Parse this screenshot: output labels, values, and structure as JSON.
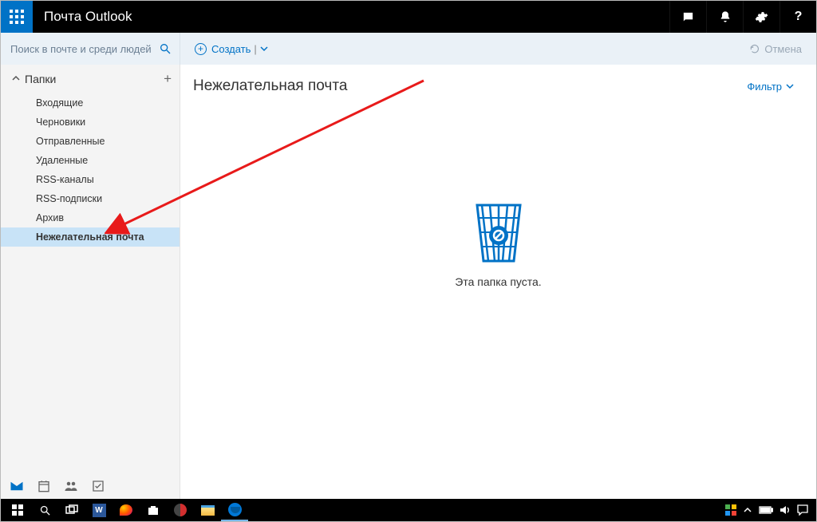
{
  "header": {
    "app_title": "Почта Outlook"
  },
  "search": {
    "placeholder": "Поиск в почте и среди людей"
  },
  "actionbar": {
    "create_label": "Создать",
    "undo_label": "Отмена"
  },
  "sidebar": {
    "folders_label": "Папки",
    "items": [
      {
        "label": "Входящие",
        "selected": false
      },
      {
        "label": "Черновики",
        "selected": false
      },
      {
        "label": "Отправленные",
        "selected": false
      },
      {
        "label": "Удаленные",
        "selected": false
      },
      {
        "label": "RSS-каналы",
        "selected": false
      },
      {
        "label": "RSS-подписки",
        "selected": false
      },
      {
        "label": "Архив",
        "selected": false
      },
      {
        "label": "Нежелательная почта",
        "selected": true
      }
    ]
  },
  "main": {
    "page_title": "Нежелательная почта",
    "filter_label": "Фильтр",
    "empty_message": "Эта папка пуста."
  }
}
